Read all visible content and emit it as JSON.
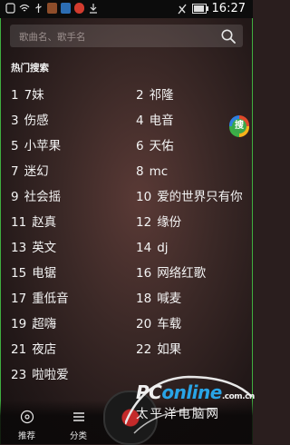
{
  "status_bar": {
    "time": "16:27"
  },
  "search": {
    "placeholder": "歌曲名、歌手名"
  },
  "hot_search": {
    "title": "热门搜索",
    "items": [
      {
        "num": "1",
        "label": "7妹"
      },
      {
        "num": "2",
        "label": "祁隆"
      },
      {
        "num": "3",
        "label": "伤感"
      },
      {
        "num": "4",
        "label": "电音"
      },
      {
        "num": "5",
        "label": "小苹果"
      },
      {
        "num": "6",
        "label": "天佑"
      },
      {
        "num": "7",
        "label": "迷幻"
      },
      {
        "num": "8",
        "label": "mc"
      },
      {
        "num": "9",
        "label": "社会摇"
      },
      {
        "num": "10",
        "label": "爱的世界只有你"
      },
      {
        "num": "11",
        "label": "赵真"
      },
      {
        "num": "12",
        "label": "缘份"
      },
      {
        "num": "13",
        "label": "英文"
      },
      {
        "num": "14",
        "label": "dj"
      },
      {
        "num": "15",
        "label": "电锯"
      },
      {
        "num": "16",
        "label": "网络红歌"
      },
      {
        "num": "17",
        "label": "重低音"
      },
      {
        "num": "18",
        "label": "喊麦"
      },
      {
        "num": "19",
        "label": "超嗨"
      },
      {
        "num": "20",
        "label": "车载"
      },
      {
        "num": "21",
        "label": "夜店"
      },
      {
        "num": "22",
        "label": "如果"
      },
      {
        "num": "23",
        "label": "啦啦爱"
      }
    ]
  },
  "side_badge": {
    "label": "搜"
  },
  "bottom_nav": {
    "recommend": "推荐",
    "category": "分类"
  },
  "watermark": {
    "brand_prefix": "PC",
    "brand_suffix": "online",
    "domain": ".com.cn",
    "cn_name": "太平洋电脑网"
  },
  "colors": {
    "accent_green": "#3fae3f",
    "brand_blue": "#29a4e6",
    "disc_red": "#c42a2a"
  }
}
